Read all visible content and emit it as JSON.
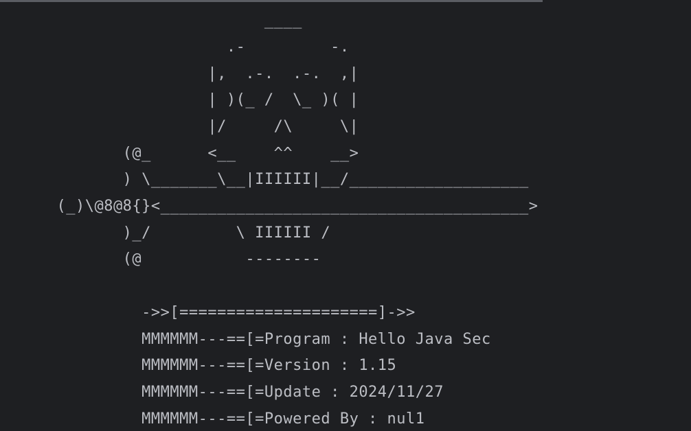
{
  "banner": {
    "lines": [
      "                            ____",
      "                        .-         -.",
      "                      |,  .-.  .-.  ,|",
      "                      | )(_ /  \\_ )( |",
      "                      |/     /\\     \\|",
      "             (@_      <__    ^^    __>",
      "             ) \\_______\\__|IIIIII|__/___________________",
      "      (_)\\@8@8{}<_______________________________________>",
      "             )_/         \\ IIIIII /",
      "             (@           --------"
    ]
  },
  "info": {
    "separator": "               ->>[=====================]->>",
    "program": "               MMMMMM---==[=Program : Hello Java Sec",
    "version": "               MMMMMM---==[=Version : 1.15",
    "update": "               MMMMMM---==[=Update : 2024/11/27",
    "powered_by": "               MMMMMM---==[=Powered By : nul1"
  },
  "colors": {
    "background": "#1e1f22",
    "text": "#bcbec4",
    "top_bar": "#5b5d63"
  }
}
